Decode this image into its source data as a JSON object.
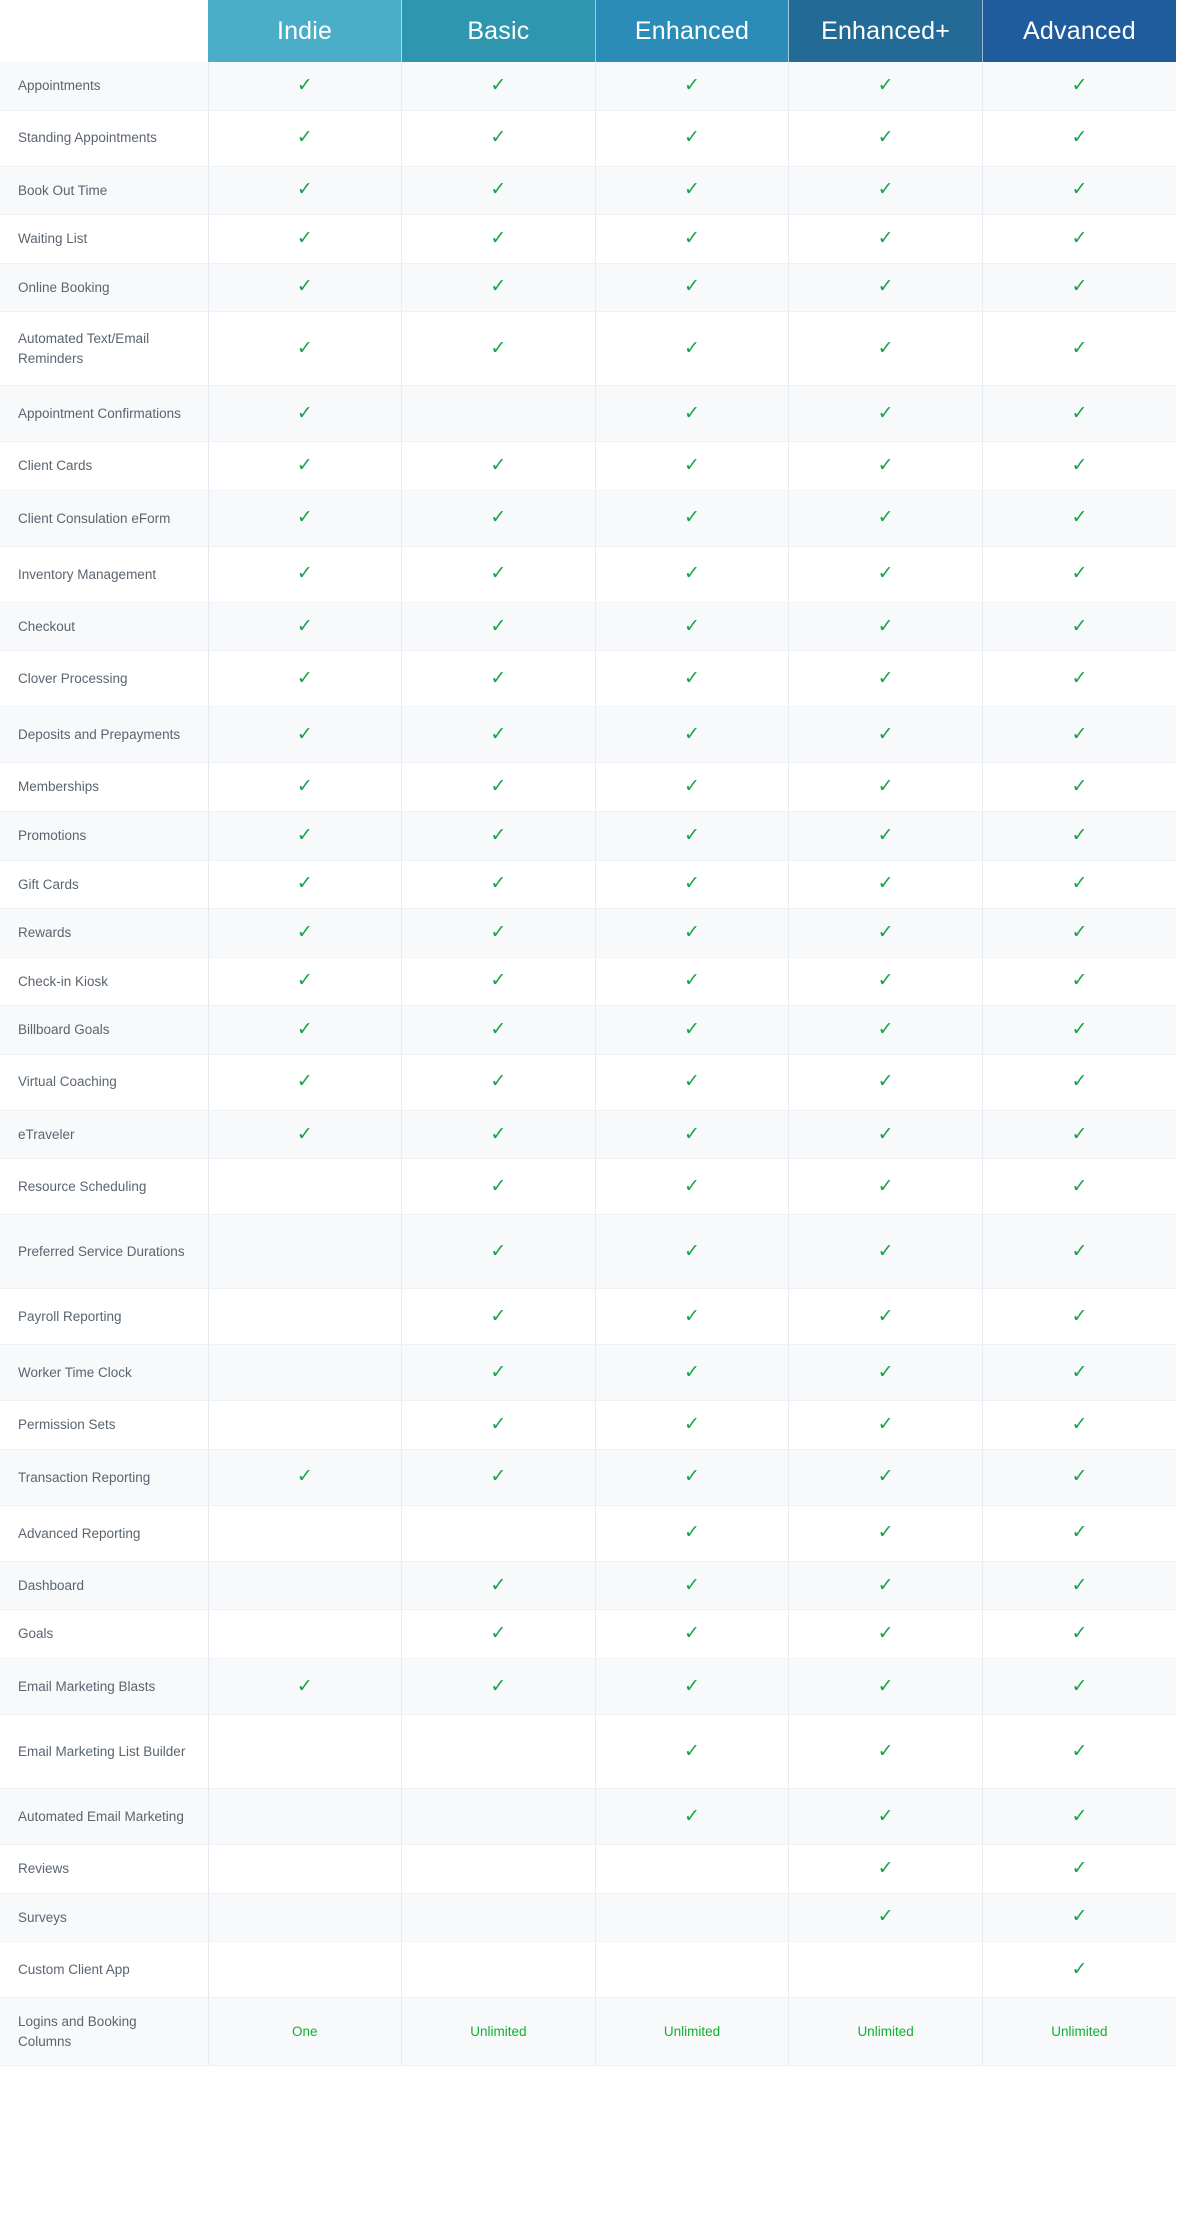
{
  "table": {
    "name": "plan-feature-comparison",
    "feature_column_header": "",
    "columns": [
      {
        "id": "indie",
        "label": "Indie",
        "header_color": "#4baec8"
      },
      {
        "id": "basic",
        "label": "Basic",
        "header_color": "#2e96ae"
      },
      {
        "id": "enhanced",
        "label": "Enhanced",
        "header_color": "#2b8cb8"
      },
      {
        "id": "enhanced_plus",
        "label": "Enhanced+",
        "header_color": "#236b96"
      },
      {
        "id": "advanced",
        "label": "Advanced",
        "header_color": "#1f5c9e"
      }
    ],
    "check_glyph": "✓",
    "colors": {
      "check_green": "#16a34a",
      "value_green": "#12b030",
      "row_label": "#5a6570",
      "stripe": "#f7f9fb",
      "grid_line": "#e9edf2"
    },
    "rows": [
      {
        "feature": "Appointments",
        "cells": [
          "check",
          "check",
          "check",
          "check",
          "check"
        ]
      },
      {
        "feature": "Standing Appointments",
        "cells": [
          "check",
          "check",
          "check",
          "check",
          "check"
        ]
      },
      {
        "feature": "Book Out Time",
        "cells": [
          "check",
          "check",
          "check",
          "check",
          "check"
        ]
      },
      {
        "feature": "Waiting List",
        "cells": [
          "check",
          "check",
          "check",
          "check",
          "check"
        ]
      },
      {
        "feature": "Online Booking",
        "cells": [
          "check",
          "check",
          "check",
          "check",
          "check"
        ]
      },
      {
        "feature": "Automated Text/Email Reminders",
        "cells": [
          "check",
          "check",
          "check",
          "check",
          "check"
        ]
      },
      {
        "feature": "Appointment Confirmations",
        "cells": [
          "check",
          "",
          "check",
          "check",
          "check"
        ]
      },
      {
        "feature": "Client Cards",
        "cells": [
          "check",
          "check",
          "check",
          "check",
          "check"
        ]
      },
      {
        "feature": "Client Consulation eForm",
        "cells": [
          "check",
          "check",
          "check",
          "check",
          "check"
        ]
      },
      {
        "feature": "Inventory Management",
        "cells": [
          "check",
          "check",
          "check",
          "check",
          "check"
        ]
      },
      {
        "feature": "Checkout",
        "cells": [
          "check",
          "check",
          "check",
          "check",
          "check"
        ]
      },
      {
        "feature": "Clover Processing",
        "cells": [
          "check",
          "check",
          "check",
          "check",
          "check"
        ]
      },
      {
        "feature": "Deposits and Prepayments",
        "cells": [
          "check",
          "check",
          "check",
          "check",
          "check"
        ]
      },
      {
        "feature": "Memberships",
        "cells": [
          "check",
          "check",
          "check",
          "check",
          "check"
        ]
      },
      {
        "feature": "Promotions",
        "cells": [
          "check",
          "check",
          "check",
          "check",
          "check"
        ]
      },
      {
        "feature": "Gift Cards",
        "cells": [
          "check",
          "check",
          "check",
          "check",
          "check"
        ]
      },
      {
        "feature": "Rewards",
        "cells": [
          "check",
          "check",
          "check",
          "check",
          "check"
        ]
      },
      {
        "feature": "Check-in Kiosk",
        "cells": [
          "check",
          "check",
          "check",
          "check",
          "check"
        ]
      },
      {
        "feature": "Billboard Goals",
        "cells": [
          "check",
          "check",
          "check",
          "check",
          "check"
        ]
      },
      {
        "feature": "Virtual Coaching",
        "cells": [
          "check",
          "check",
          "check",
          "check",
          "check"
        ]
      },
      {
        "feature": "eTraveler",
        "cells": [
          "check",
          "check",
          "check",
          "check",
          "check"
        ]
      },
      {
        "feature": "Resource Scheduling",
        "cells": [
          "",
          "check",
          "check",
          "check",
          "check"
        ]
      },
      {
        "feature": "Preferred Service Durations",
        "cells": [
          "",
          "check",
          "check",
          "check",
          "check"
        ]
      },
      {
        "feature": "Payroll Reporting",
        "cells": [
          "",
          "check",
          "check",
          "check",
          "check"
        ]
      },
      {
        "feature": "Worker Time Clock",
        "cells": [
          "",
          "check",
          "check",
          "check",
          "check"
        ]
      },
      {
        "feature": "Permission Sets",
        "cells": [
          "",
          "check",
          "check",
          "check",
          "check"
        ]
      },
      {
        "feature": "Transaction Reporting",
        "cells": [
          "check",
          "check",
          "check",
          "check",
          "check"
        ]
      },
      {
        "feature": "Advanced Reporting",
        "cells": [
          "",
          "",
          "check",
          "check",
          "check"
        ]
      },
      {
        "feature": "Dashboard",
        "cells": [
          "",
          "check",
          "check",
          "check",
          "check"
        ]
      },
      {
        "feature": "Goals",
        "cells": [
          "",
          "check",
          "check",
          "check",
          "check"
        ]
      },
      {
        "feature": "Email Marketing Blasts",
        "cells": [
          "check",
          "check",
          "check",
          "check",
          "check"
        ]
      },
      {
        "feature": "Email Marketing List Builder",
        "cells": [
          "",
          "",
          "check",
          "check",
          "check"
        ]
      },
      {
        "feature": "Automated Email Marketing",
        "cells": [
          "",
          "",
          "check",
          "check",
          "check"
        ]
      },
      {
        "feature": "Reviews",
        "cells": [
          "",
          "",
          "",
          "check",
          "check"
        ]
      },
      {
        "feature": "Surveys",
        "cells": [
          "",
          "",
          "",
          "check",
          "check"
        ]
      },
      {
        "feature": "Custom Client App",
        "cells": [
          "",
          "",
          "",
          "",
          "check"
        ]
      },
      {
        "feature": "Logins and Booking Columns",
        "cells": [
          "One",
          "Unlimited",
          "Unlimited",
          "Unlimited",
          "Unlimited"
        ],
        "value_row": true
      }
    ]
  }
}
